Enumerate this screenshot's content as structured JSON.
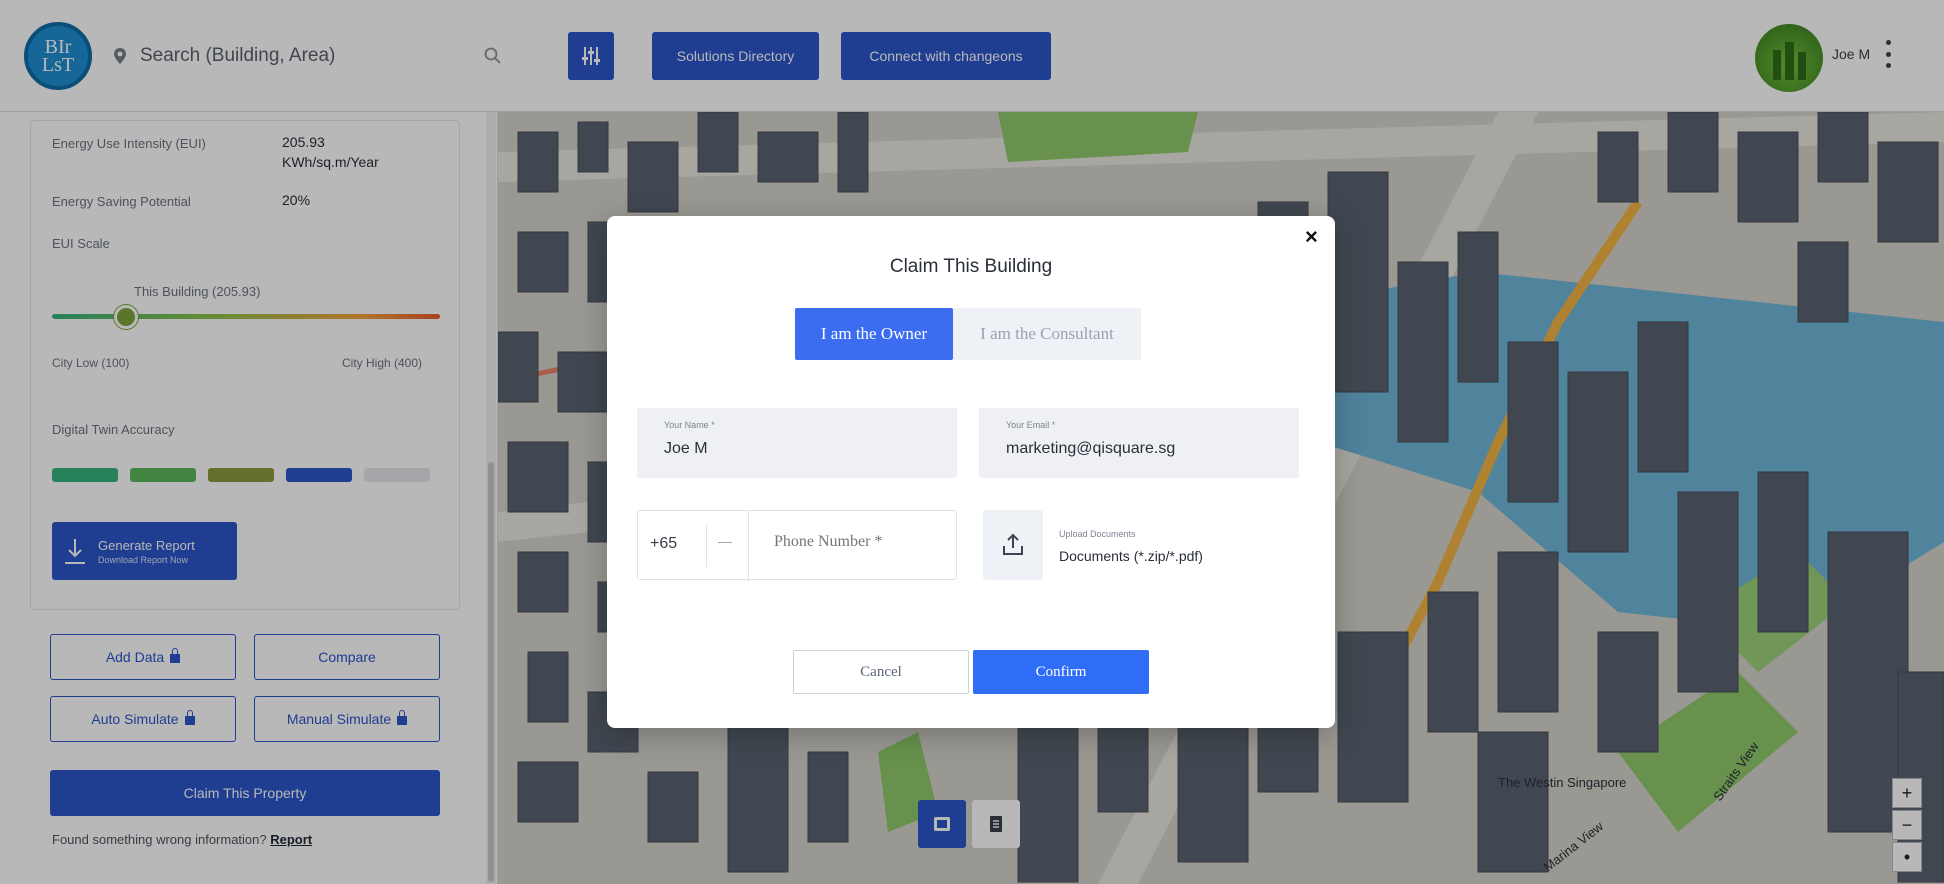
{
  "header": {
    "logo_text": "BIr\nLsT",
    "search_placeholder": "Search (Building, Area)",
    "solutions_btn": "Solutions Directory",
    "connect_btn": "Connect with changeons",
    "user_name": "Joe M"
  },
  "panel": {
    "eui_label": "Energy Use Intensity (EUI)",
    "eui_value": "205.93",
    "eui_unit": "KWh/sq.m/Year",
    "savings_label": "Energy Saving Potential",
    "savings_value": "20%",
    "eui_scale_label": "EUI Scale",
    "slider_tag": "This Building (205.93)",
    "slider_value_pct": 19,
    "city_low": "City Low (100)",
    "city_high": "City High (400)",
    "accuracy_label": "Digital Twin Accuracy",
    "accuracy_colors": [
      "#36b37e",
      "#5cb85c",
      "#8a9a3d",
      "#2b55c9",
      "#e4e7eb"
    ],
    "generate_title": "Generate Report",
    "generate_sub": "Download Report Now",
    "add_data": "Add Data",
    "compare": "Compare",
    "auto_simulate": "Auto Simulate",
    "manual_simulate": "Manual Simulate",
    "claim_property": "Claim This Property",
    "found_text": "Found something wrong information?",
    "report_link": "Report"
  },
  "map": {
    "labels": [
      "The Westin Singapore",
      "Marina View",
      "Straits View"
    ],
    "zoom_in": "+",
    "zoom_out": "−",
    "compass": "•"
  },
  "modal": {
    "title": "Claim This Building",
    "tab_owner": "I am the Owner",
    "tab_consultant": "I am the Consultant",
    "name_label": "Your Name *",
    "name_value": "Joe M",
    "email_label": "Your Email *",
    "email_value": "marketing@qisquare.sg",
    "country_code": "+65",
    "phone_placeholder": "Phone Number *",
    "upload_label": "Upload Documents",
    "upload_value": "Documents (*.zip/*.pdf)",
    "cancel": "Cancel",
    "confirm": "Confirm",
    "close": "×"
  },
  "colors": {
    "primary": "#2b55c9",
    "tab_active": "#3c6cf0",
    "confirm": "#2f6df6",
    "water": "#6fb6d9",
    "park": "#8fc96a",
    "building": "#5b6370"
  }
}
